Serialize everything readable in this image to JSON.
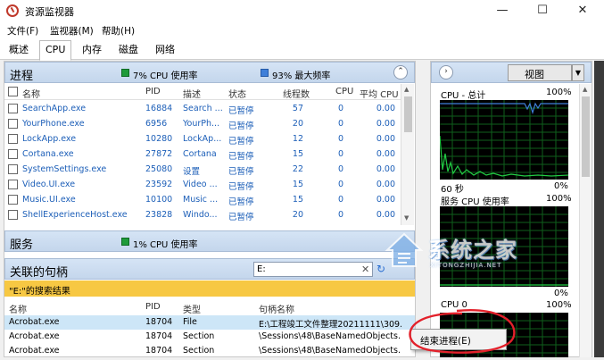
{
  "window": {
    "title": "资源监视器"
  },
  "menu": [
    "文件(F)",
    "监视器(M)",
    "帮助(H)"
  ],
  "tabs": [
    "概述",
    "CPU",
    "内存",
    "磁盘",
    "网络"
  ],
  "process_panel": {
    "title": "进程",
    "cpu_usage": "7% CPU 使用率",
    "max_freq": "93% 最大频率",
    "columns": [
      "名称",
      "PID",
      "描述",
      "状态",
      "线程数",
      "CPU",
      "平均 CPU"
    ],
    "rows": [
      [
        "SearchApp.exe",
        "16884",
        "Search ...",
        "已暂停",
        "57",
        "0",
        "0.00"
      ],
      [
        "YourPhone.exe",
        "6956",
        "YourPh...",
        "已暂停",
        "20",
        "0",
        "0.00"
      ],
      [
        "LockApp.exe",
        "10280",
        "LockAp...",
        "已暂停",
        "12",
        "0",
        "0.00"
      ],
      [
        "Cortana.exe",
        "27872",
        "Cortana",
        "已暂停",
        "15",
        "0",
        "0.00"
      ],
      [
        "SystemSettings.exe",
        "25080",
        "设置",
        "已暂停",
        "22",
        "0",
        "0.00"
      ],
      [
        "Video.UI.exe",
        "23592",
        "Video ...",
        "已暂停",
        "15",
        "0",
        "0.00"
      ],
      [
        "Music.UI.exe",
        "10100",
        "Music ...",
        "已暂停",
        "15",
        "0",
        "0.00"
      ],
      [
        "ShellExperienceHost.exe",
        "23828",
        "Windo...",
        "已暂停",
        "20",
        "0",
        "0.00"
      ]
    ]
  },
  "services_panel": {
    "title": "服务",
    "cpu_usage": "1% CPU 使用率"
  },
  "handles_panel": {
    "title": "关联的句柄",
    "search_value": "E:",
    "results_label": "\"E:\"的搜索结果",
    "columns": [
      "名称",
      "PID",
      "类型",
      "句柄名称"
    ],
    "rows": [
      [
        "Acrobat.exe",
        "18704",
        "File",
        "E:\\工程竣工文件整理20211111\\309..."
      ],
      [
        "Acrobat.exe",
        "18704",
        "Section",
        "\\Sessions\\48\\BaseNamedObjects..."
      ],
      [
        "Acrobat.exe",
        "18704",
        "Section",
        "\\Sessions\\48\\BaseNamedObjects..."
      ]
    ]
  },
  "context_menu": {
    "end_process": "结束进程(E)"
  },
  "right_pane": {
    "view_label": "视图",
    "graphs": [
      {
        "title": "CPU - 总计",
        "top_pct": "100%",
        "bottom_left": "60 秒",
        "bottom_right": "0%"
      },
      {
        "title": "服务 CPU 使用率",
        "top_pct": "100%",
        "bottom_left": "",
        "bottom_right": "0%"
      },
      {
        "title": "CPU 0",
        "top_pct": "100%",
        "bottom_left": "",
        "bottom_right": ""
      }
    ]
  },
  "watermark": {
    "text": "系统之家",
    "sub": "XITONGZHIJIA.NET"
  },
  "colors": {
    "graph_line": "#22cc44",
    "graph_bg": "#000000",
    "legend_green": "#1e9b3a",
    "legend_blue": "#3f7fd9",
    "results_bar": "#f7c843",
    "selected_row": "#cde6f7",
    "annotation_red": "#e3212b"
  }
}
